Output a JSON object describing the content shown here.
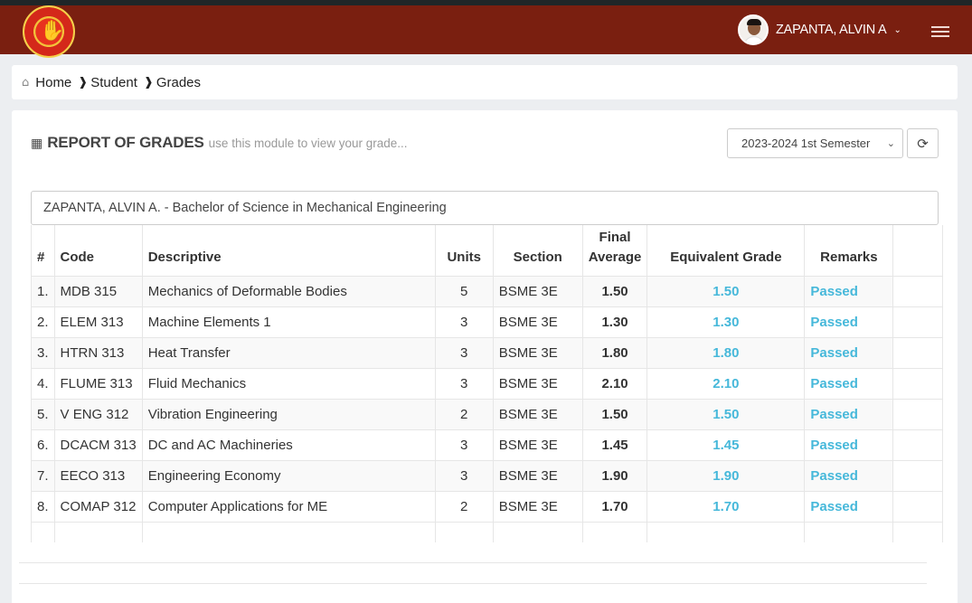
{
  "user": {
    "name": "ZAPANTA, ALVIN A"
  },
  "breadcrumb": {
    "home": "Home",
    "student": "Student",
    "grades": "Grades"
  },
  "panel": {
    "title": "REPORT OF GRADES",
    "subtitle": "use this module to view your grade...",
    "semester_selected": "2023-2024 1st Semester"
  },
  "student_info": "ZAPANTA, ALVIN A. - Bachelor of Science in Mechanical Engineering",
  "table": {
    "headers": {
      "num": "#",
      "code": "Code",
      "descriptive": "Descriptive",
      "units": "Units",
      "section": "Section",
      "final_1": "Final",
      "final_2": "Average",
      "equivalent": "Equivalent Grade",
      "remarks": "Remarks"
    },
    "rows": [
      {
        "num": "1.",
        "code": "MDB 315",
        "desc": "Mechanics of Deformable Bodies",
        "units": "5",
        "section": "BSME 3E",
        "final": "1.50",
        "eq": "1.50",
        "remarks": "Passed"
      },
      {
        "num": "2.",
        "code": "ELEM 313",
        "desc": "Machine Elements 1",
        "units": "3",
        "section": "BSME 3E",
        "final": "1.30",
        "eq": "1.30",
        "remarks": "Passed"
      },
      {
        "num": "3.",
        "code": "HTRN 313",
        "desc": "Heat Transfer",
        "units": "3",
        "section": "BSME 3E",
        "final": "1.80",
        "eq": "1.80",
        "remarks": "Passed"
      },
      {
        "num": "4.",
        "code": "FLUME 313",
        "desc": "Fluid Mechanics",
        "units": "3",
        "section": "BSME 3E",
        "final": "2.10",
        "eq": "2.10",
        "remarks": "Passed"
      },
      {
        "num": "5.",
        "code": "V ENG 312",
        "desc": "Vibration Engineering",
        "units": "2",
        "section": "BSME 3E",
        "final": "1.50",
        "eq": "1.50",
        "remarks": "Passed"
      },
      {
        "num": "6.",
        "code": "DCACM 313",
        "desc": "DC and AC Machineries",
        "units": "3",
        "section": "BSME 3E",
        "final": "1.45",
        "eq": "1.45",
        "remarks": "Passed"
      },
      {
        "num": "7.",
        "code": "EECO 313",
        "desc": "Engineering Economy",
        "units": "3",
        "section": "BSME 3E",
        "final": "1.90",
        "eq": "1.90",
        "remarks": "Passed"
      },
      {
        "num": "8.",
        "code": "COMAP 312",
        "desc": "Computer Applications for ME",
        "units": "2",
        "section": "BSME 3E",
        "final": "1.70",
        "eq": "1.70",
        "remarks": "Passed"
      }
    ]
  },
  "colors": {
    "navbar": "#7a1f10",
    "accent": "#46b8da"
  },
  "icons": {
    "home": "home-icon",
    "table": "table-icon",
    "refresh": "refresh-icon",
    "menu": "hamburger-menu-icon",
    "caret": "chevron-down-icon"
  }
}
